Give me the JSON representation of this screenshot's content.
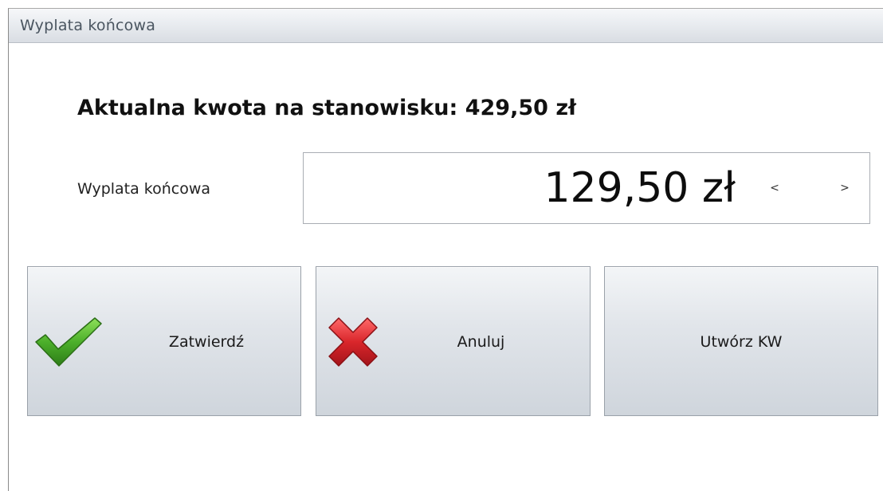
{
  "window": {
    "title": "Wyplata końcowa"
  },
  "summary": {
    "current_amount_text": "Aktualna kwota na stanowisku: 429,50 zł"
  },
  "payout": {
    "label": "Wyplata końcowa",
    "value": "129,50 zł",
    "prev_label": "<",
    "next_label": ">"
  },
  "buttons": {
    "confirm_label": "Zatwierdź",
    "cancel_label": "Anuluj",
    "create_kw_label": "Utwórz KW"
  },
  "icons": {
    "confirm": "checkmark-icon",
    "cancel": "cross-icon"
  },
  "colors": {
    "check_green": "#4caf2a",
    "cross_red": "#d9262b"
  }
}
